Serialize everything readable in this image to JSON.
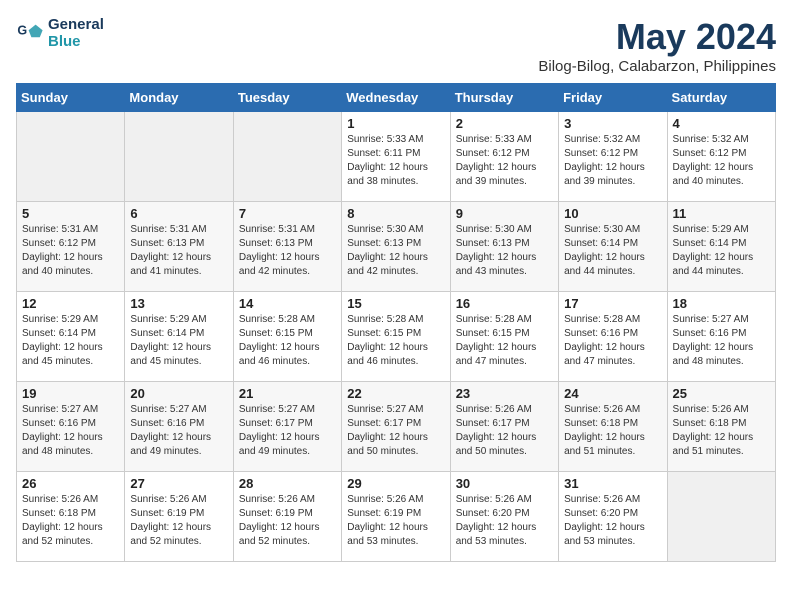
{
  "header": {
    "logo_line1": "General",
    "logo_line2": "Blue",
    "title": "May 2024",
    "subtitle": "Bilog-Bilog, Calabarzon, Philippines"
  },
  "weekdays": [
    "Sunday",
    "Monday",
    "Tuesday",
    "Wednesday",
    "Thursday",
    "Friday",
    "Saturday"
  ],
  "weeks": [
    [
      {
        "day": "",
        "sunrise": "",
        "sunset": "",
        "daylight": ""
      },
      {
        "day": "",
        "sunrise": "",
        "sunset": "",
        "daylight": ""
      },
      {
        "day": "",
        "sunrise": "",
        "sunset": "",
        "daylight": ""
      },
      {
        "day": "1",
        "sunrise": "Sunrise: 5:33 AM",
        "sunset": "Sunset: 6:11 PM",
        "daylight": "Daylight: 12 hours and 38 minutes."
      },
      {
        "day": "2",
        "sunrise": "Sunrise: 5:33 AM",
        "sunset": "Sunset: 6:12 PM",
        "daylight": "Daylight: 12 hours and 39 minutes."
      },
      {
        "day": "3",
        "sunrise": "Sunrise: 5:32 AM",
        "sunset": "Sunset: 6:12 PM",
        "daylight": "Daylight: 12 hours and 39 minutes."
      },
      {
        "day": "4",
        "sunrise": "Sunrise: 5:32 AM",
        "sunset": "Sunset: 6:12 PM",
        "daylight": "Daylight: 12 hours and 40 minutes."
      }
    ],
    [
      {
        "day": "5",
        "sunrise": "Sunrise: 5:31 AM",
        "sunset": "Sunset: 6:12 PM",
        "daylight": "Daylight: 12 hours and 40 minutes."
      },
      {
        "day": "6",
        "sunrise": "Sunrise: 5:31 AM",
        "sunset": "Sunset: 6:13 PM",
        "daylight": "Daylight: 12 hours and 41 minutes."
      },
      {
        "day": "7",
        "sunrise": "Sunrise: 5:31 AM",
        "sunset": "Sunset: 6:13 PM",
        "daylight": "Daylight: 12 hours and 42 minutes."
      },
      {
        "day": "8",
        "sunrise": "Sunrise: 5:30 AM",
        "sunset": "Sunset: 6:13 PM",
        "daylight": "Daylight: 12 hours and 42 minutes."
      },
      {
        "day": "9",
        "sunrise": "Sunrise: 5:30 AM",
        "sunset": "Sunset: 6:13 PM",
        "daylight": "Daylight: 12 hours and 43 minutes."
      },
      {
        "day": "10",
        "sunrise": "Sunrise: 5:30 AM",
        "sunset": "Sunset: 6:14 PM",
        "daylight": "Daylight: 12 hours and 44 minutes."
      },
      {
        "day": "11",
        "sunrise": "Sunrise: 5:29 AM",
        "sunset": "Sunset: 6:14 PM",
        "daylight": "Daylight: 12 hours and 44 minutes."
      }
    ],
    [
      {
        "day": "12",
        "sunrise": "Sunrise: 5:29 AM",
        "sunset": "Sunset: 6:14 PM",
        "daylight": "Daylight: 12 hours and 45 minutes."
      },
      {
        "day": "13",
        "sunrise": "Sunrise: 5:29 AM",
        "sunset": "Sunset: 6:14 PM",
        "daylight": "Daylight: 12 hours and 45 minutes."
      },
      {
        "day": "14",
        "sunrise": "Sunrise: 5:28 AM",
        "sunset": "Sunset: 6:15 PM",
        "daylight": "Daylight: 12 hours and 46 minutes."
      },
      {
        "day": "15",
        "sunrise": "Sunrise: 5:28 AM",
        "sunset": "Sunset: 6:15 PM",
        "daylight": "Daylight: 12 hours and 46 minutes."
      },
      {
        "day": "16",
        "sunrise": "Sunrise: 5:28 AM",
        "sunset": "Sunset: 6:15 PM",
        "daylight": "Daylight: 12 hours and 47 minutes."
      },
      {
        "day": "17",
        "sunrise": "Sunrise: 5:28 AM",
        "sunset": "Sunset: 6:16 PM",
        "daylight": "Daylight: 12 hours and 47 minutes."
      },
      {
        "day": "18",
        "sunrise": "Sunrise: 5:27 AM",
        "sunset": "Sunset: 6:16 PM",
        "daylight": "Daylight: 12 hours and 48 minutes."
      }
    ],
    [
      {
        "day": "19",
        "sunrise": "Sunrise: 5:27 AM",
        "sunset": "Sunset: 6:16 PM",
        "daylight": "Daylight: 12 hours and 48 minutes."
      },
      {
        "day": "20",
        "sunrise": "Sunrise: 5:27 AM",
        "sunset": "Sunset: 6:16 PM",
        "daylight": "Daylight: 12 hours and 49 minutes."
      },
      {
        "day": "21",
        "sunrise": "Sunrise: 5:27 AM",
        "sunset": "Sunset: 6:17 PM",
        "daylight": "Daylight: 12 hours and 49 minutes."
      },
      {
        "day": "22",
        "sunrise": "Sunrise: 5:27 AM",
        "sunset": "Sunset: 6:17 PM",
        "daylight": "Daylight: 12 hours and 50 minutes."
      },
      {
        "day": "23",
        "sunrise": "Sunrise: 5:26 AM",
        "sunset": "Sunset: 6:17 PM",
        "daylight": "Daylight: 12 hours and 50 minutes."
      },
      {
        "day": "24",
        "sunrise": "Sunrise: 5:26 AM",
        "sunset": "Sunset: 6:18 PM",
        "daylight": "Daylight: 12 hours and 51 minutes."
      },
      {
        "day": "25",
        "sunrise": "Sunrise: 5:26 AM",
        "sunset": "Sunset: 6:18 PM",
        "daylight": "Daylight: 12 hours and 51 minutes."
      }
    ],
    [
      {
        "day": "26",
        "sunrise": "Sunrise: 5:26 AM",
        "sunset": "Sunset: 6:18 PM",
        "daylight": "Daylight: 12 hours and 52 minutes."
      },
      {
        "day": "27",
        "sunrise": "Sunrise: 5:26 AM",
        "sunset": "Sunset: 6:19 PM",
        "daylight": "Daylight: 12 hours and 52 minutes."
      },
      {
        "day": "28",
        "sunrise": "Sunrise: 5:26 AM",
        "sunset": "Sunset: 6:19 PM",
        "daylight": "Daylight: 12 hours and 52 minutes."
      },
      {
        "day": "29",
        "sunrise": "Sunrise: 5:26 AM",
        "sunset": "Sunset: 6:19 PM",
        "daylight": "Daylight: 12 hours and 53 minutes."
      },
      {
        "day": "30",
        "sunrise": "Sunrise: 5:26 AM",
        "sunset": "Sunset: 6:20 PM",
        "daylight": "Daylight: 12 hours and 53 minutes."
      },
      {
        "day": "31",
        "sunrise": "Sunrise: 5:26 AM",
        "sunset": "Sunset: 6:20 PM",
        "daylight": "Daylight: 12 hours and 53 minutes."
      },
      {
        "day": "",
        "sunrise": "",
        "sunset": "",
        "daylight": ""
      }
    ]
  ]
}
